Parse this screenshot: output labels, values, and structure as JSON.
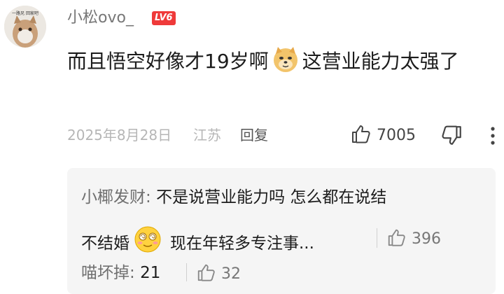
{
  "comment": {
    "username": "小松ovo_",
    "level_badge": "LV6",
    "avatar_caption": "一路兄 回家吧",
    "text_before_emoji": "而且悟空好像才19岁啊",
    "text_after_emoji": "这营业能力太强了",
    "emoji_icon": "doge-emoji-icon",
    "date": "2025年8月28日",
    "location": "江苏",
    "reply_label": "回复",
    "like_count": "7005"
  },
  "reply": {
    "author": "小椰发财:",
    "text_line1": "不是说营业能力吗  怎么都在说结",
    "text_line2_before": "不结婚",
    "emoji_icon": "dizzy-face-emoji-icon",
    "text_line2_after": "现在年轻多专注事...",
    "like_count": "396"
  },
  "reply2": {
    "author": "喵坏掉:",
    "text": "21",
    "like_count": "32"
  },
  "colors": {
    "badge": "#ef3a3a",
    "muted": "#b6b6b6",
    "reply_bg": "#f5f5f5"
  }
}
